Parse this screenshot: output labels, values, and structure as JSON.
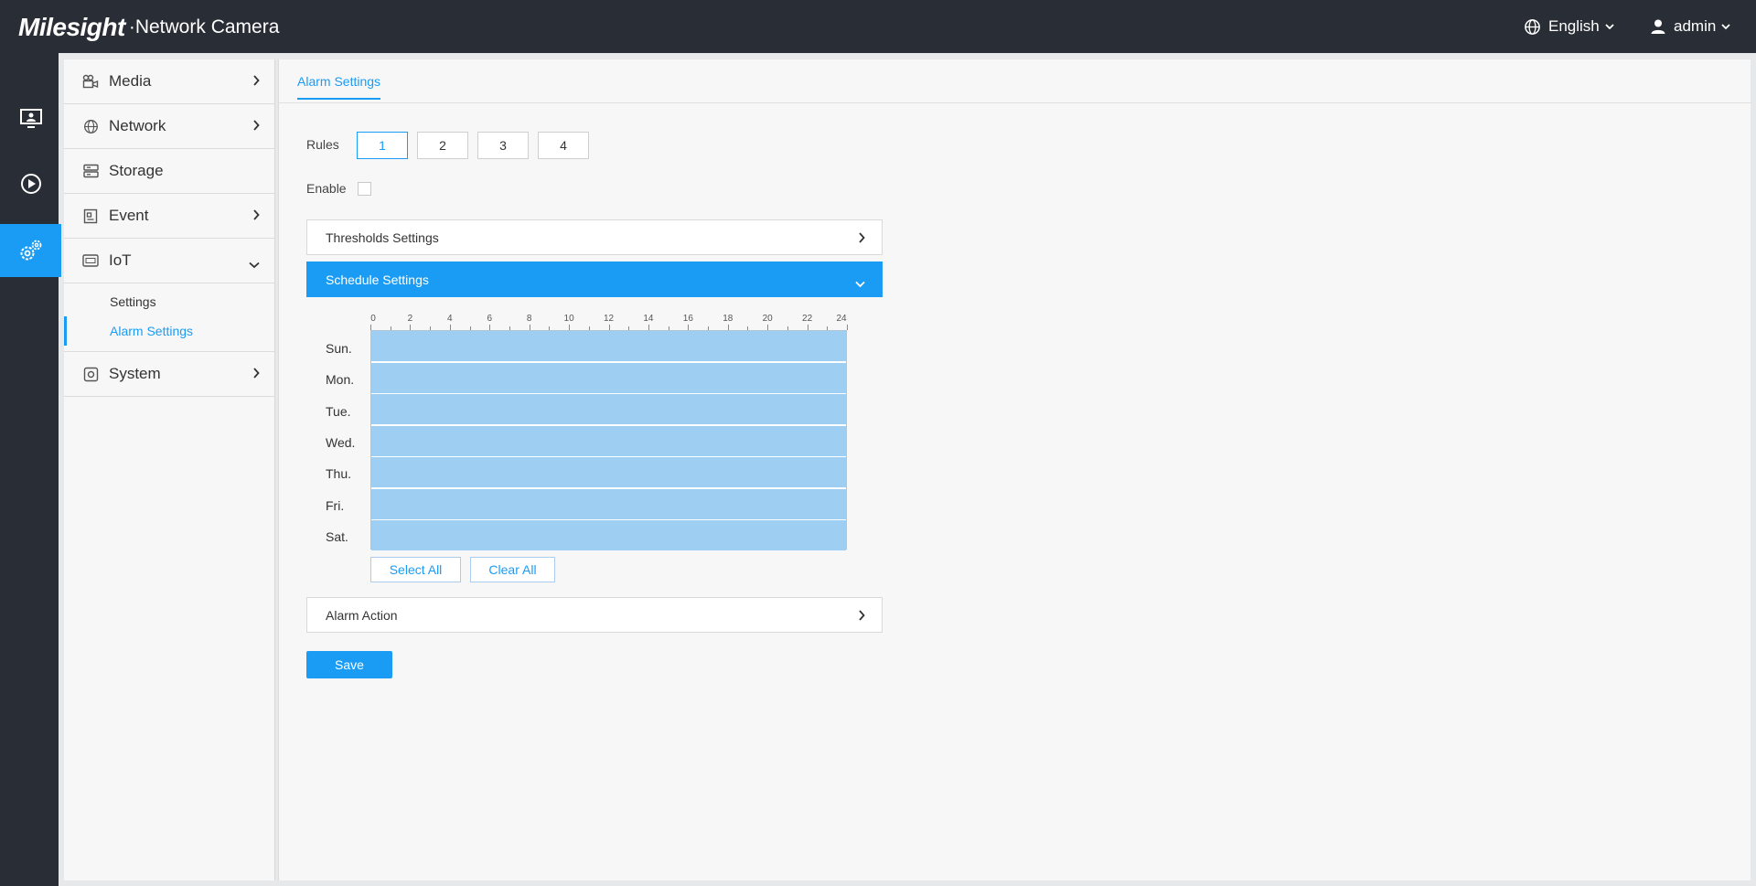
{
  "header": {
    "brand": "Milesight",
    "product": "·Network Camera",
    "language": "English",
    "user": "admin"
  },
  "rail": {
    "items": [
      {
        "icon": "live-view-icon"
      },
      {
        "icon": "playback-icon"
      },
      {
        "icon": "settings-icon",
        "active": true
      }
    ]
  },
  "sidebar": {
    "items": [
      {
        "label": "Media",
        "icon": "camera-icon",
        "arrow": "chevron-right"
      },
      {
        "label": "Network",
        "icon": "globe-icon",
        "arrow": "chevron-right"
      },
      {
        "label": "Storage",
        "icon": "storage-icon"
      },
      {
        "label": "Event",
        "icon": "event-icon",
        "arrow": "chevron-right"
      },
      {
        "label": "IoT",
        "icon": "iot-icon",
        "arrow": "chevron-down"
      },
      {
        "label": "System",
        "icon": "system-icon",
        "arrow": "chevron-right"
      }
    ],
    "iot_sub": [
      "Settings",
      "Alarm Settings"
    ]
  },
  "main": {
    "tab": "Alarm Settings",
    "rules_label": "Rules",
    "rules": [
      "1",
      "2",
      "3",
      "4"
    ],
    "active_rule": "1",
    "enable_label": "Enable",
    "enabled": false,
    "sections": {
      "thresholds": "Thresholds Settings",
      "schedule": "Schedule Settings",
      "alarm_action": "Alarm Action"
    },
    "schedule": {
      "hours": [
        "0",
        "2",
        "4",
        "6",
        "8",
        "10",
        "12",
        "14",
        "16",
        "18",
        "20",
        "22",
        "24"
      ],
      "days": [
        "Sun.",
        "Mon.",
        "Tue.",
        "Wed.",
        "Thu.",
        "Fri.",
        "Sat."
      ],
      "select_all": "Select All",
      "clear_all": "Clear All"
    },
    "save": "Save"
  },
  "colors": {
    "accent": "#1a9cf5",
    "topbar": "#292d36",
    "schedule_fill": "#9ecff2"
  }
}
